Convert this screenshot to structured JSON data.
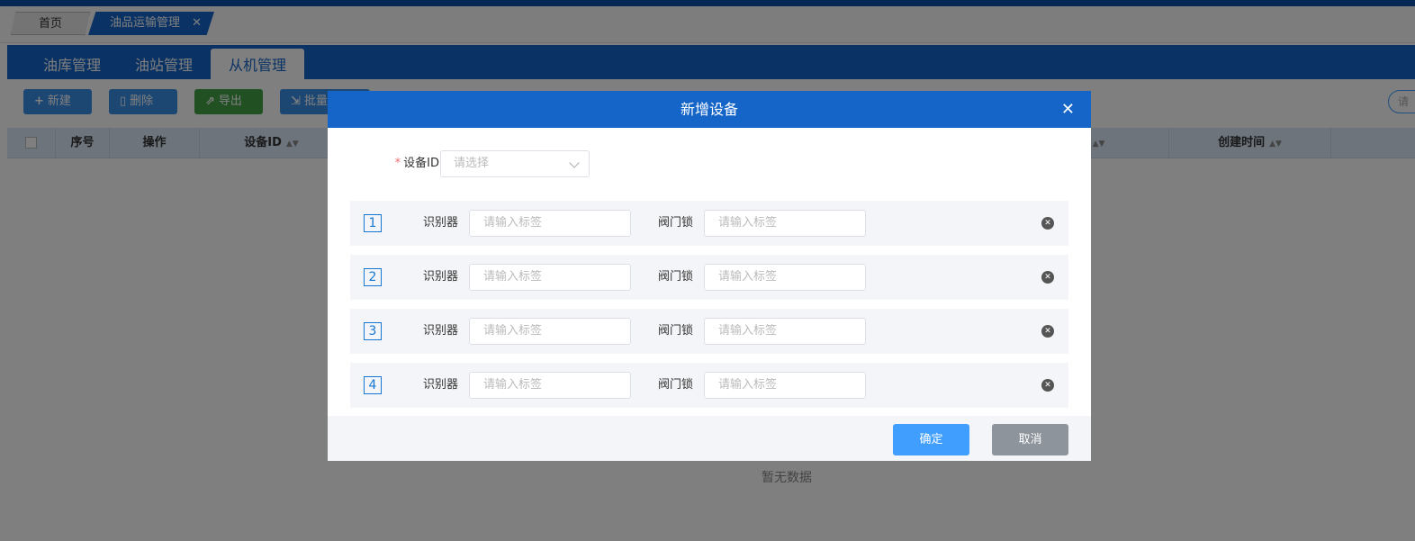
{
  "page_tabs": {
    "home": "首页",
    "active": "油品运输管理",
    "close_glyph": "✕"
  },
  "module_tabs": [
    "油库管理",
    "油站管理",
    "从机管理"
  ],
  "toolbar": {
    "new_label": "新建",
    "delete_label": "删除",
    "export_label": "导出",
    "batch_label": "批量",
    "search_placeholder": "请"
  },
  "table": {
    "columns": [
      "序号",
      "操作",
      "设备ID",
      "",
      "创建时间"
    ],
    "empty_text": "暂无数据"
  },
  "dialog": {
    "title": "新增设备",
    "close_glyph": "✕",
    "device_id_label": "设备ID",
    "device_id_placeholder": "请选择",
    "rows": [
      {
        "index": "1",
        "label_a": "识别器",
        "placeholder_a": "请输入标签",
        "label_b": "阀门锁",
        "placeholder_b": "请输入标签"
      },
      {
        "index": "2",
        "label_a": "识别器",
        "placeholder_a": "请输入标签",
        "label_b": "阀门锁",
        "placeholder_b": "请输入标签"
      },
      {
        "index": "3",
        "label_a": "识别器",
        "placeholder_a": "请输入标签",
        "label_b": "阀门锁",
        "placeholder_b": "请输入标签"
      },
      {
        "index": "4",
        "label_a": "识别器",
        "placeholder_a": "请输入标签",
        "label_b": "阀门锁",
        "placeholder_b": "请输入标签"
      }
    ],
    "confirm_label": "确定",
    "cancel_label": "取消"
  },
  "colors": {
    "primary": "#1565c8",
    "confirm": "#409eff",
    "cancel": "#8d949c",
    "export_green": "#43a047"
  }
}
